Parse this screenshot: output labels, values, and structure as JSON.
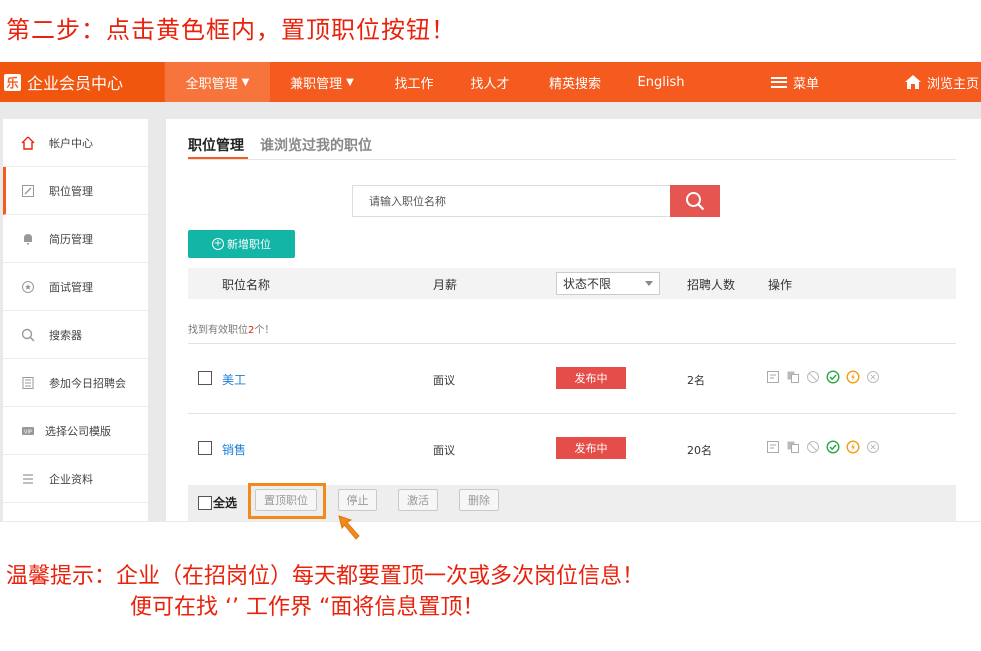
{
  "instruction": {
    "step": "第二步：点击黄色框内，置顶职位按钮！"
  },
  "topbar": {
    "logo_mark": "乐",
    "logo_text": "企业会员中心",
    "nav": [
      {
        "label": "全职管理",
        "has_caret": true,
        "active": true
      },
      {
        "label": "兼职管理",
        "has_caret": true,
        "active": false
      },
      {
        "label": "找工作",
        "has_caret": false,
        "active": false
      },
      {
        "label": "找人才",
        "has_caret": false,
        "active": false
      },
      {
        "label": "精英搜索",
        "has_caret": false,
        "active": false
      },
      {
        "label": "English",
        "has_caret": false,
        "active": false
      }
    ],
    "menu_label": "菜单",
    "home_label": "浏览主页",
    "colors": {
      "bar": "#f55a1e",
      "active": "#f7743d"
    }
  },
  "sidebar": {
    "items": [
      {
        "label": "帐户中心",
        "icon": "home-icon"
      },
      {
        "label": "职位管理",
        "icon": "edit-icon",
        "active": true
      },
      {
        "label": "简历管理",
        "icon": "bell-icon"
      },
      {
        "label": "面试管理",
        "icon": "star-icon"
      },
      {
        "label": "搜索器",
        "icon": "search-icon"
      },
      {
        "label": "参加今日招聘会",
        "icon": "building-icon"
      },
      {
        "label": "选择公司模版",
        "icon": "vip-icon"
      },
      {
        "label": "企业资料",
        "icon": "list-icon"
      }
    ]
  },
  "main": {
    "tabs": [
      {
        "label": "职位管理",
        "active": true
      },
      {
        "label": "谁浏览过我的职位",
        "active": false
      }
    ],
    "search": {
      "placeholder": "请输入职位名称"
    },
    "add_button": "新增职位",
    "table": {
      "headers": {
        "name": "职位名称",
        "salary": "月薪",
        "status_filter": "状态不限",
        "count": "招聘人数",
        "ops": "操作"
      },
      "found_prefix": "找到有效职位",
      "found_count": "2",
      "found_suffix": "个！",
      "rows": [
        {
          "name": "美工",
          "salary": "面议",
          "status": "发布中",
          "count": "2名"
        },
        {
          "name": "销售",
          "salary": "面议",
          "status": "发布中",
          "count": "20名"
        }
      ],
      "op_icons": [
        "preview-icon",
        "copy-icon",
        "pause-icon",
        "check-circle-icon",
        "lightning-icon",
        "close-circle-icon"
      ]
    },
    "footer": {
      "select_all": "全选",
      "buttons": [
        "置顶职位",
        "停止",
        "激活",
        "删除"
      ],
      "highlighted_button": "置顶职位",
      "highlight_color": "#f08a1a"
    }
  },
  "tip": {
    "line1": "温馨提示：企业（在招岗位）每天都要置顶一次或多次岗位信息！",
    "line2": "便可在找 ‘’ 工作界 “面将信息置顶！"
  }
}
